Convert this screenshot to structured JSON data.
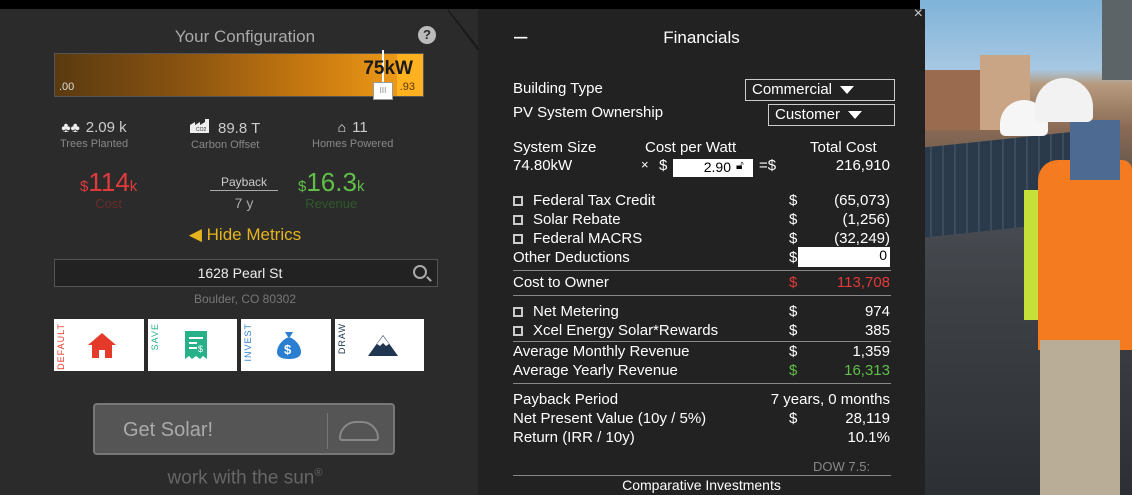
{
  "config": {
    "title": "Your Configuration",
    "help_icon": "?",
    "slider": {
      "min": ".00",
      "max": ".93",
      "value": "75kW",
      "thumb": "III"
    },
    "trees": {
      "value": "2.09 k",
      "label": "Trees Planted"
    },
    "carbon": {
      "value": "89.8 T",
      "label": "Carbon Offset",
      "badge": "CO2"
    },
    "homes": {
      "value": "11",
      "label": "Homes Powered"
    },
    "cost": {
      "prefix": "$",
      "value": "114",
      "suffix": "k",
      "label": "Cost"
    },
    "payback": {
      "label": "Payback",
      "value": "7 y"
    },
    "revenue": {
      "prefix": "$",
      "value": "16.3",
      "suffix": "k",
      "label": "Revenue"
    },
    "hide_metrics": "Hide Metrics",
    "address": {
      "street": "1628 Pearl St",
      "city": "Boulder, CO 80302"
    },
    "modes": [
      {
        "label": "DEFAULT",
        "color": "#e53a2a"
      },
      {
        "label": "SAVE",
        "color": "#27b08a"
      },
      {
        "label": "INVEST",
        "color": "#2a7fd1"
      },
      {
        "label": "DRAW",
        "color": "#1f3550"
      }
    ],
    "get_solar": "Get Solar!",
    "tagline": "work with the sun",
    "tagline_mark": "®"
  },
  "financials": {
    "header": "Financials",
    "minus": "–",
    "close": "×",
    "building_type": {
      "label": "Building Type",
      "value": "Commercial"
    },
    "ownership": {
      "label": "PV System Ownership",
      "value": "Customer"
    },
    "system": {
      "size_label": "System Size",
      "size": "74.80kW",
      "cpw_label": "Cost per Watt",
      "times": "×",
      "dollar": "$",
      "cpw": "2.90",
      "total_label": "Total Cost",
      "eq": "=$",
      "total": "216,910"
    },
    "deductions": [
      {
        "label": "Federal Tax Credit",
        "dollar": "$",
        "value": "(65,073)"
      },
      {
        "label": "Solar Rebate",
        "dollar": "$",
        "value": "(1,256)"
      },
      {
        "label": "Federal MACRS",
        "dollar": "$",
        "value": "(32,249)"
      }
    ],
    "other": {
      "label": "Other Deductions",
      "dollar": "$",
      "value": "0"
    },
    "cost_to_owner": {
      "label": "Cost to Owner",
      "dollar": "$",
      "value": "113,708"
    },
    "revenue_items": [
      {
        "label": "Net Metering",
        "dollar": "$",
        "value": "974"
      },
      {
        "label": "Xcel Energy Solar*Rewards",
        "dollar": "$",
        "value": "385"
      }
    ],
    "avg_monthly": {
      "label": "Average Monthly Revenue",
      "dollar": "$",
      "value": "1,359"
    },
    "avg_yearly": {
      "label": "Average Yearly Revenue",
      "dollar": "$",
      "value": "16,313"
    },
    "payback": {
      "label": "Payback Period",
      "value": "7 years, 0 months"
    },
    "npv": {
      "label": "Net Present Value (10y / 5%)",
      "dollar": "$",
      "value": "28,119"
    },
    "irr": {
      "label": "Return (IRR / 10y)",
      "value": "10.1%"
    },
    "dow": "DOW 7.5:",
    "comparative": "Comparative Investments"
  }
}
